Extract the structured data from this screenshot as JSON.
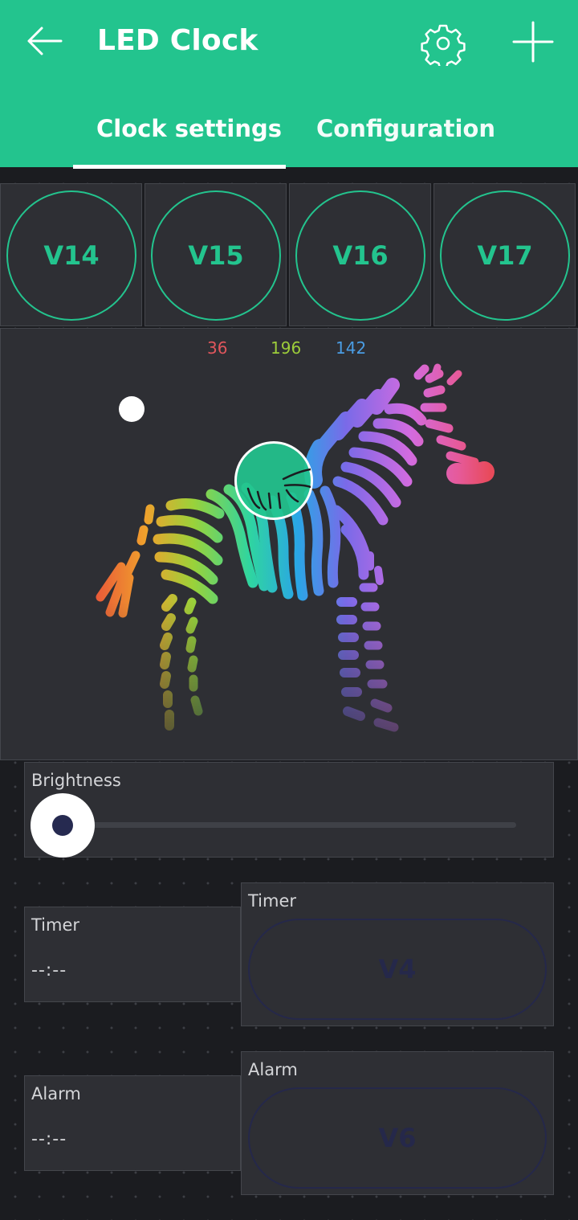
{
  "header": {
    "title": "LED Clock",
    "tabs": [
      "Clock settings",
      "Configuration"
    ],
    "active_tab": "Clock settings",
    "accent_color": "#23c48e"
  },
  "pins": [
    "V14",
    "V15",
    "V16",
    "V17"
  ],
  "color_picker": {
    "r": "36",
    "g": "196",
    "b": "142",
    "selected_color": "#23c48e"
  },
  "brightness": {
    "label": "Brightness",
    "value": 0
  },
  "timer": {
    "label": "Timer",
    "value": "--:--",
    "button_label": "Timer",
    "button_pin": "V4"
  },
  "alarm": {
    "label": "Alarm",
    "value": "--:--",
    "button_label": "Alarm",
    "button_pin": "V6"
  },
  "icons": [
    "back-arrow-icon",
    "gear-icon",
    "plus-icon"
  ]
}
